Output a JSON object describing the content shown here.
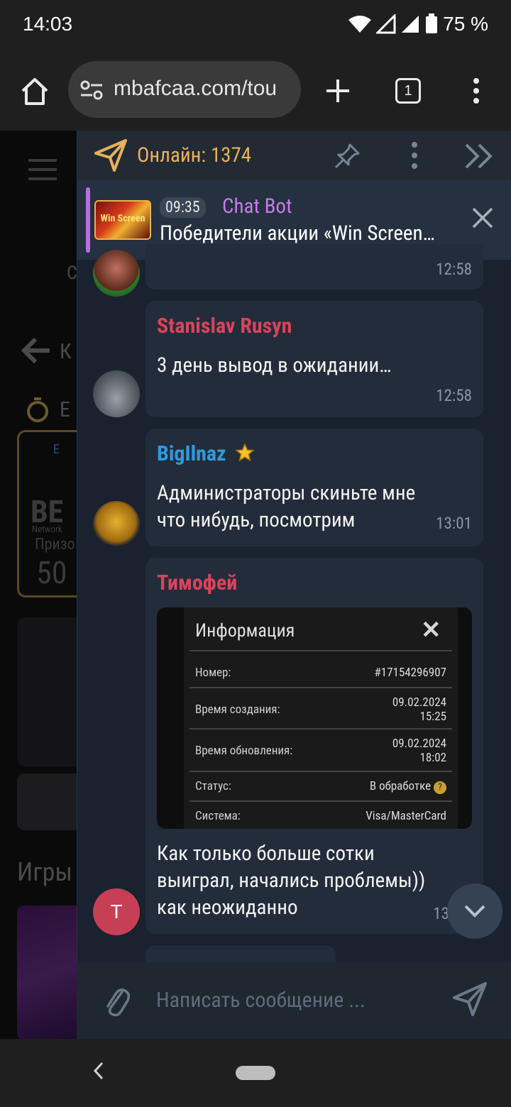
{
  "status_bar": {
    "time": "14:03",
    "battery": "75 %"
  },
  "browser": {
    "url": "mbafcaa.com/tou",
    "tab_count": "1"
  },
  "site_bg": {
    "t1": "С",
    "t2": "К",
    "t3": "Е",
    "t4": "Е",
    "t5": "BE",
    "t6": "Network",
    "t7": "Призо",
    "t8": "50",
    "t9": "Игры"
  },
  "chat": {
    "online_label": "Онлайн: 1374",
    "pinned": {
      "time": "09:35",
      "author": "Chat Bot",
      "text": "Победители акции «Win Screen…",
      "thumb_text": "Win Screen"
    },
    "messages": [
      {
        "time": "12:58"
      },
      {
        "author": "Stanislav Rusyn",
        "text": "3 день вывод в ожидании…",
        "time": "12:58"
      },
      {
        "author": "BigIlnaz",
        "text_line1": "Администраторы скиньте мне",
        "text_line2": "что нибудь, посмотрим",
        "time": "13:01"
      },
      {
        "author": "Тимофей",
        "avatar_letter": "T",
        "text_line1": "Как только больше сотки",
        "text_line2": "выиграл, начались проблемы))",
        "text_line3": "как неожиданно",
        "time": "13"
      }
    ],
    "info_image": {
      "title": "Информация",
      "rows": [
        {
          "label": "Номер:",
          "value": "#17154296907"
        },
        {
          "label": "Время создания:",
          "value": "09.02.2024",
          "value2": "15:25"
        },
        {
          "label": "Время обновления:",
          "value": "09.02.2024",
          "value2": "18:02"
        },
        {
          "label": "Статус:",
          "value": "В обработке"
        },
        {
          "label": "Система:",
          "value": "Visa/MasterCard"
        }
      ]
    },
    "input_placeholder": "Написать сообщение ..."
  },
  "colors": {
    "accent_gold": "#e8b25a",
    "bot_purple": "#c77ce8",
    "author_red": "#d9435c",
    "author_blue": "#2d9be0"
  }
}
